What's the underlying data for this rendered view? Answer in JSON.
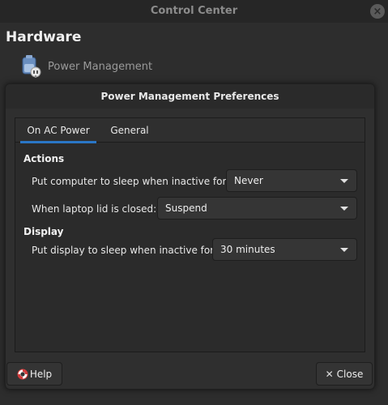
{
  "control_center": {
    "title": "Control Center",
    "section_heading": "Hardware",
    "item_label": "Power Management"
  },
  "dialog": {
    "title": "Power Management Preferences",
    "tabs": [
      {
        "label": "On AC Power",
        "active": true
      },
      {
        "label": "General",
        "active": false
      }
    ],
    "actions": {
      "heading": "Actions",
      "sleep_label": "Put computer to sleep when inactive for:",
      "sleep_value": "Never",
      "lid_label": "When laptop lid is closed:",
      "lid_value": "Suspend"
    },
    "display": {
      "heading": "Display",
      "display_sleep_label": "Put display to sleep when inactive for:",
      "display_sleep_value": "30 minutes"
    },
    "buttons": {
      "help_label": "Help",
      "close_label": "Close"
    }
  },
  "colors": {
    "accent": "#2a76c6",
    "background": "#2d2d2d"
  },
  "icons": {
    "titlebar_close": "close-icon",
    "power_item": "power-management-icon",
    "help": "lifebuoy-icon",
    "close": "x-icon",
    "combo": "chevron-down-icon"
  }
}
